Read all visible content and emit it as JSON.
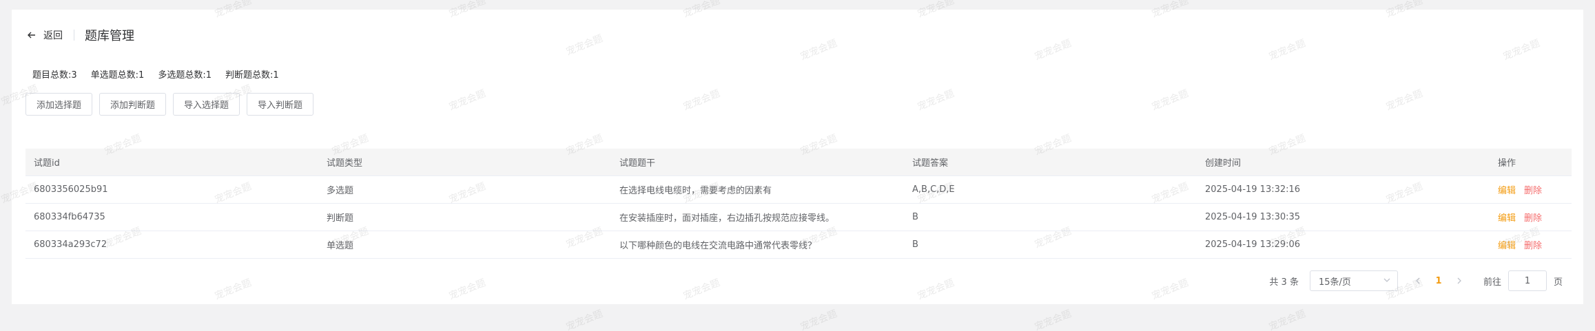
{
  "header": {
    "back_label": "返回",
    "title": "题库管理"
  },
  "stats": {
    "total": "题目总数:3",
    "single": "单选题总数:1",
    "multi": "多选题总数:1",
    "judge": "判断题总数:1"
  },
  "buttons": {
    "add_choice": "添加选择题",
    "add_judge": "添加判断题",
    "import_choice": "导入选择题",
    "import_judge": "导入判断题"
  },
  "table": {
    "columns": [
      "试题id",
      "试题类型",
      "试题题干",
      "试题答案",
      "创建时间",
      "操作"
    ],
    "rows": [
      {
        "id": "6803356025b91",
        "type": "多选题",
        "stem": "在选择电线电缆时，需要考虑的因素有",
        "answer": "A,B,C,D,E",
        "created": "2025-04-19 13:32:16"
      },
      {
        "id": "680334fb64735",
        "type": "判断题",
        "stem": "在安装插座时，面对插座，右边插孔按规范应接零线。",
        "answer": "B",
        "created": "2025-04-19 13:30:35"
      },
      {
        "id": "680334a293c72",
        "type": "单选题",
        "stem": "以下哪种颜色的电线在交流电路中通常代表零线？",
        "answer": "B",
        "created": "2025-04-19 13:29:06"
      }
    ],
    "edit_label": "编辑",
    "delete_label": "删除"
  },
  "pagination": {
    "total": "共 3 条",
    "page_size": "15条/页",
    "current_page": "1",
    "goto_prefix": "前往",
    "goto_value": "1",
    "goto_suffix": "页"
  },
  "watermark": "宠宠会题",
  "colors": {
    "accent": "#f39c12",
    "danger": "#f56c6c"
  }
}
